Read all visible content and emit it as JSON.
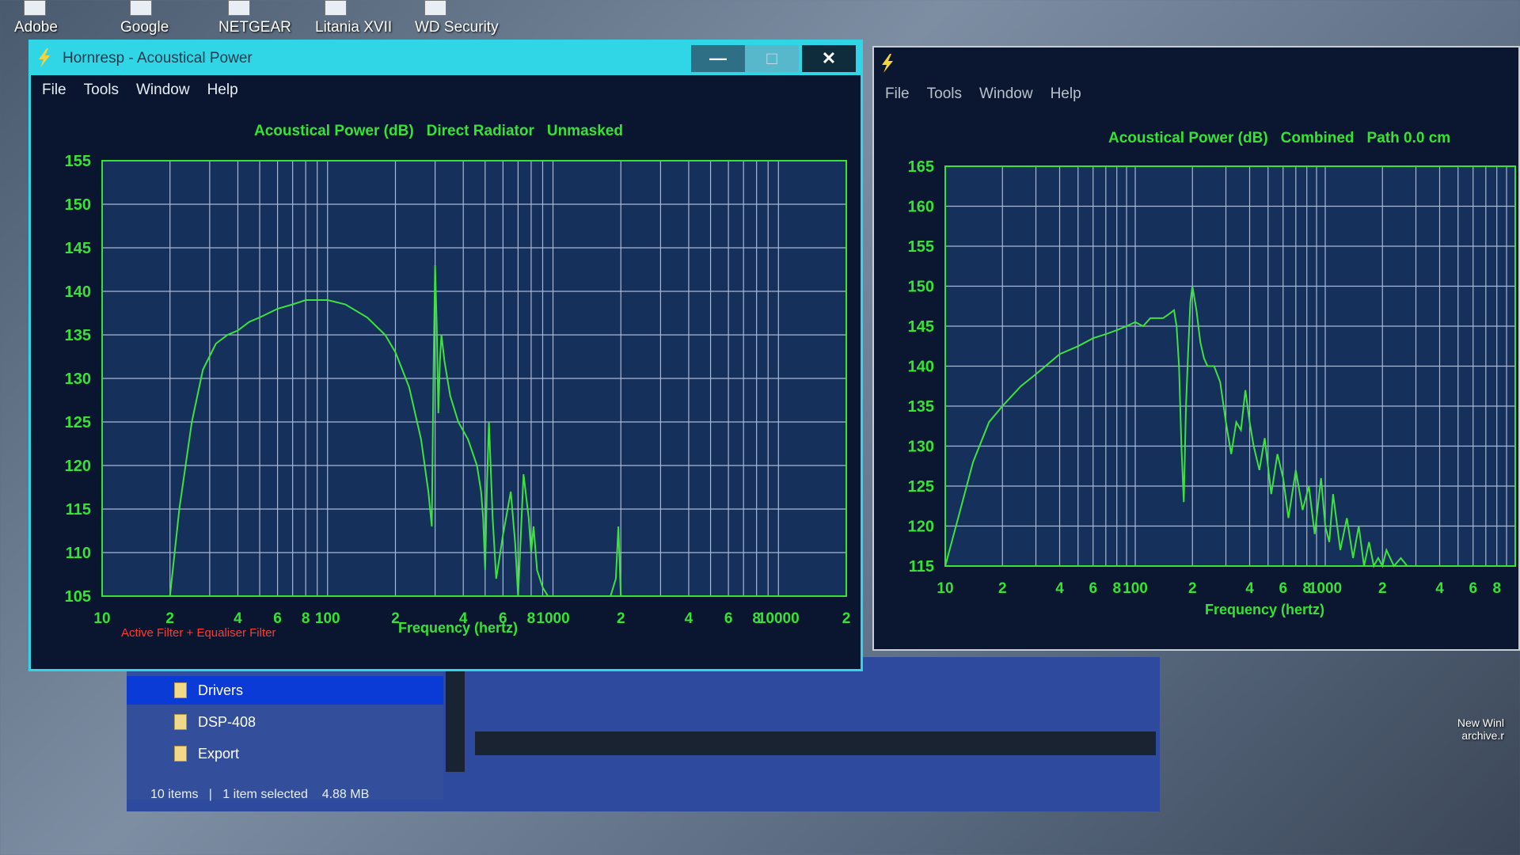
{
  "desktop": {
    "shortcuts": [
      "Adobe",
      "Google",
      "NETGEAR",
      "Litania XVII",
      "WD Security"
    ],
    "right_icon_label": "New Winl archive.r"
  },
  "left_window": {
    "title": "Hornresp - Acoustical Power",
    "menu": [
      "File",
      "Tools",
      "Window",
      "Help"
    ],
    "buttons": {
      "minimize": "—",
      "maximize": "□",
      "close": "✕"
    },
    "chart_title": [
      "Acoustical Power (dB)",
      "Direct Radiator",
      "Unmasked"
    ],
    "x_label": "Frequency (hertz)",
    "filter_note": "Active Filter + Equaliser Filter"
  },
  "right_window": {
    "menu": [
      "File",
      "Tools",
      "Window",
      "Help"
    ],
    "chart_title": [
      "Acoustical Power (dB)",
      "Combined",
      "Path 0.0 cm"
    ],
    "x_label": "Frequency (hertz)"
  },
  "explorer": {
    "items": [
      "Drivers",
      "DSP-408",
      "Export"
    ],
    "selected_index": 0,
    "status": {
      "count": "10 items",
      "selection": "1 item selected",
      "size": "4.88 MB"
    }
  },
  "colors": {
    "curve": "#3ee23e",
    "grid": "#a8b8d8",
    "frame": "#36e236",
    "window_accent": "#30d6e6"
  },
  "chart_data": [
    {
      "type": "line",
      "title": "Acoustical Power (dB) Direct Radiator Unmasked",
      "xlabel": "Frequency (hertz)",
      "ylabel": "",
      "x_scale": "log",
      "xlim": [
        10,
        20000
      ],
      "ylim": [
        105,
        155
      ],
      "y_ticks": [
        105,
        110,
        115,
        120,
        125,
        130,
        135,
        140,
        145,
        150,
        155
      ],
      "x_tick_labels": [
        {
          "x": 10,
          "label": "10"
        },
        {
          "x": 20,
          "label": "2"
        },
        {
          "x": 40,
          "label": "4"
        },
        {
          "x": 60,
          "label": "6"
        },
        {
          "x": 80,
          "label": "8"
        },
        {
          "x": 100,
          "label": "100"
        },
        {
          "x": 200,
          "label": "2"
        },
        {
          "x": 400,
          "label": "4"
        },
        {
          "x": 600,
          "label": "6"
        },
        {
          "x": 800,
          "label": "8"
        },
        {
          "x": 1000,
          "label": "1000"
        },
        {
          "x": 2000,
          "label": "2"
        },
        {
          "x": 4000,
          "label": "4"
        },
        {
          "x": 6000,
          "label": "6"
        },
        {
          "x": 8000,
          "label": "8"
        },
        {
          "x": 10000,
          "label": "10000"
        },
        {
          "x": 20000,
          "label": "2"
        }
      ],
      "grid": true,
      "series": [
        {
          "x": [
            20,
            22,
            25,
            28,
            32,
            36,
            40,
            45,
            50,
            60,
            70,
            80,
            90,
            100,
            120,
            150,
            180,
            200,
            230,
            260,
            280,
            290,
            295,
            300,
            305,
            310,
            315,
            320,
            330,
            350,
            380,
            420,
            460,
            480,
            490,
            500,
            510,
            520,
            540,
            560,
            600,
            650,
            680,
            700,
            720,
            740,
            780,
            800,
            820,
            850,
            900,
            950,
            1000,
            1050,
            1100,
            1150,
            1200,
            1300,
            1350,
            1400,
            1600,
            1800,
            1900,
            1950,
            2000
          ],
          "y": [
            105,
            115,
            125,
            131,
            134,
            135,
            135.5,
            136.5,
            137,
            138,
            138.5,
            139,
            139,
            139,
            138.5,
            137,
            135,
            133,
            129,
            123,
            117,
            113,
            130,
            143,
            136,
            126,
            132,
            135,
            132,
            128,
            125,
            123,
            120,
            117,
            114,
            108,
            118,
            125,
            114,
            107,
            112,
            117,
            111,
            105,
            112,
            119,
            114,
            110,
            113,
            108,
            106,
            105,
            105,
            105,
            105,
            105,
            105,
            105,
            105,
            105,
            105,
            105,
            107,
            113,
            105
          ]
        }
      ]
    },
    {
      "type": "line",
      "title": "Acoustical Power (dB) Combined Path 0.0 cm",
      "xlabel": "Frequency (hertz)",
      "ylabel": "",
      "x_scale": "log",
      "xlim": [
        10,
        10000
      ],
      "ylim": [
        115,
        165
      ],
      "y_ticks": [
        115,
        120,
        125,
        130,
        135,
        140,
        145,
        150,
        155,
        160,
        165
      ],
      "x_tick_labels": [
        {
          "x": 10,
          "label": "10"
        },
        {
          "x": 20,
          "label": "2"
        },
        {
          "x": 40,
          "label": "4"
        },
        {
          "x": 60,
          "label": "6"
        },
        {
          "x": 80,
          "label": "8"
        },
        {
          "x": 100,
          "label": "100"
        },
        {
          "x": 200,
          "label": "2"
        },
        {
          "x": 400,
          "label": "4"
        },
        {
          "x": 600,
          "label": "6"
        },
        {
          "x": 800,
          "label": "8"
        },
        {
          "x": 1000,
          "label": "1000"
        },
        {
          "x": 2000,
          "label": "2"
        },
        {
          "x": 4000,
          "label": "4"
        },
        {
          "x": 6000,
          "label": "6"
        },
        {
          "x": 8000,
          "label": "8"
        }
      ],
      "grid": true,
      "series": [
        {
          "x": [
            10,
            12,
            14,
            17,
            20,
            25,
            30,
            40,
            50,
            60,
            70,
            80,
            90,
            100,
            110,
            120,
            130,
            140,
            150,
            160,
            165,
            170,
            175,
            180,
            185,
            190,
            195,
            200,
            210,
            220,
            230,
            240,
            260,
            280,
            300,
            320,
            340,
            360,
            380,
            400,
            420,
            450,
            480,
            520,
            560,
            600,
            640,
            700,
            760,
            820,
            880,
            950,
            1000,
            1050,
            1100,
            1200,
            1300,
            1400,
            1500,
            1600,
            1700,
            1800,
            1900,
            2000,
            2100,
            2300,
            2500,
            2700
          ],
          "y": [
            115,
            122,
            128,
            133,
            135,
            137.5,
            139,
            141.5,
            142.5,
            143.5,
            144,
            144.5,
            145,
            145.5,
            145,
            146,
            146,
            146,
            146.5,
            147,
            145,
            140,
            130,
            123,
            135,
            142,
            148,
            150,
            147,
            143,
            141,
            140,
            140,
            138,
            133,
            129,
            133,
            132,
            137,
            133,
            130,
            127,
            131,
            124,
            129,
            126,
            121,
            127,
            122,
            125,
            119,
            126,
            120,
            118,
            124,
            117,
            121,
            116,
            120,
            115,
            118,
            115,
            116,
            115,
            117,
            115,
            116,
            115
          ]
        }
      ]
    }
  ]
}
